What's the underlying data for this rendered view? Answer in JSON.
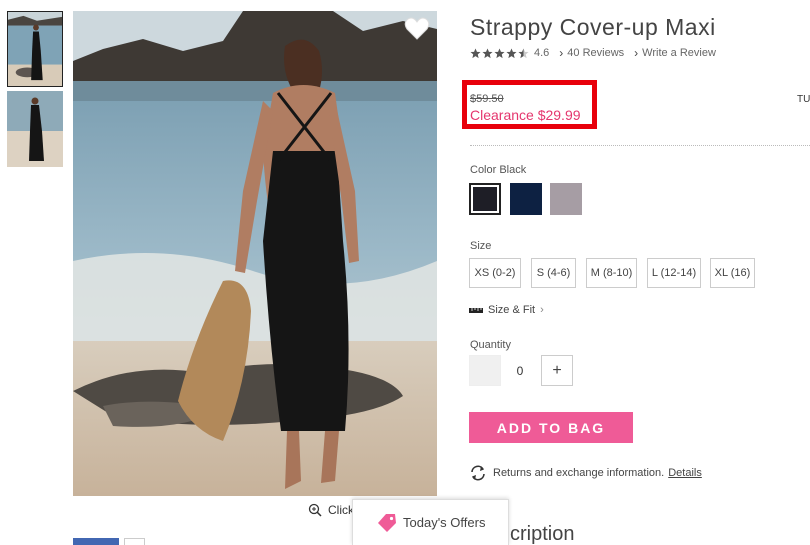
{
  "product": {
    "title": "Strappy Cover-up Maxi",
    "rating": "4.6",
    "rating_stars": 4.5,
    "reviews_link": "40 Reviews",
    "write_review_link": "Write a Review"
  },
  "price": {
    "original": "$59.50",
    "clearance": "Clearance $29.99",
    "cut_off_text": "TU"
  },
  "color": {
    "label": "Color Black",
    "swatches": [
      {
        "name": "Black",
        "hex": "#1e1e26",
        "selected": true
      },
      {
        "name": "Navy",
        "hex": "#0d2142",
        "selected": false
      },
      {
        "name": "Taupe",
        "hex": "#a69da4",
        "selected": false
      }
    ]
  },
  "size": {
    "label": "Size",
    "options": [
      "XS (0-2)",
      "S (4-6)",
      "M (8-10)",
      "L (12-14)",
      "XL (16)"
    ],
    "fit_link": "Size & Fit"
  },
  "quantity": {
    "label": "Quantity",
    "value": "0",
    "plus": "+"
  },
  "actions": {
    "add_to_bag": "ADD TO BAG",
    "returns_text": "Returns and exchange information.",
    "details_link": "Details"
  },
  "gallery": {
    "zoom_text": "Click"
  },
  "offers": {
    "label": "Today's Offers"
  },
  "description": {
    "heading": "cription"
  },
  "colors": {
    "sale_pink": "#e5366e",
    "button_pink": "#ef5b97",
    "highlight_red": "#e8000b"
  }
}
